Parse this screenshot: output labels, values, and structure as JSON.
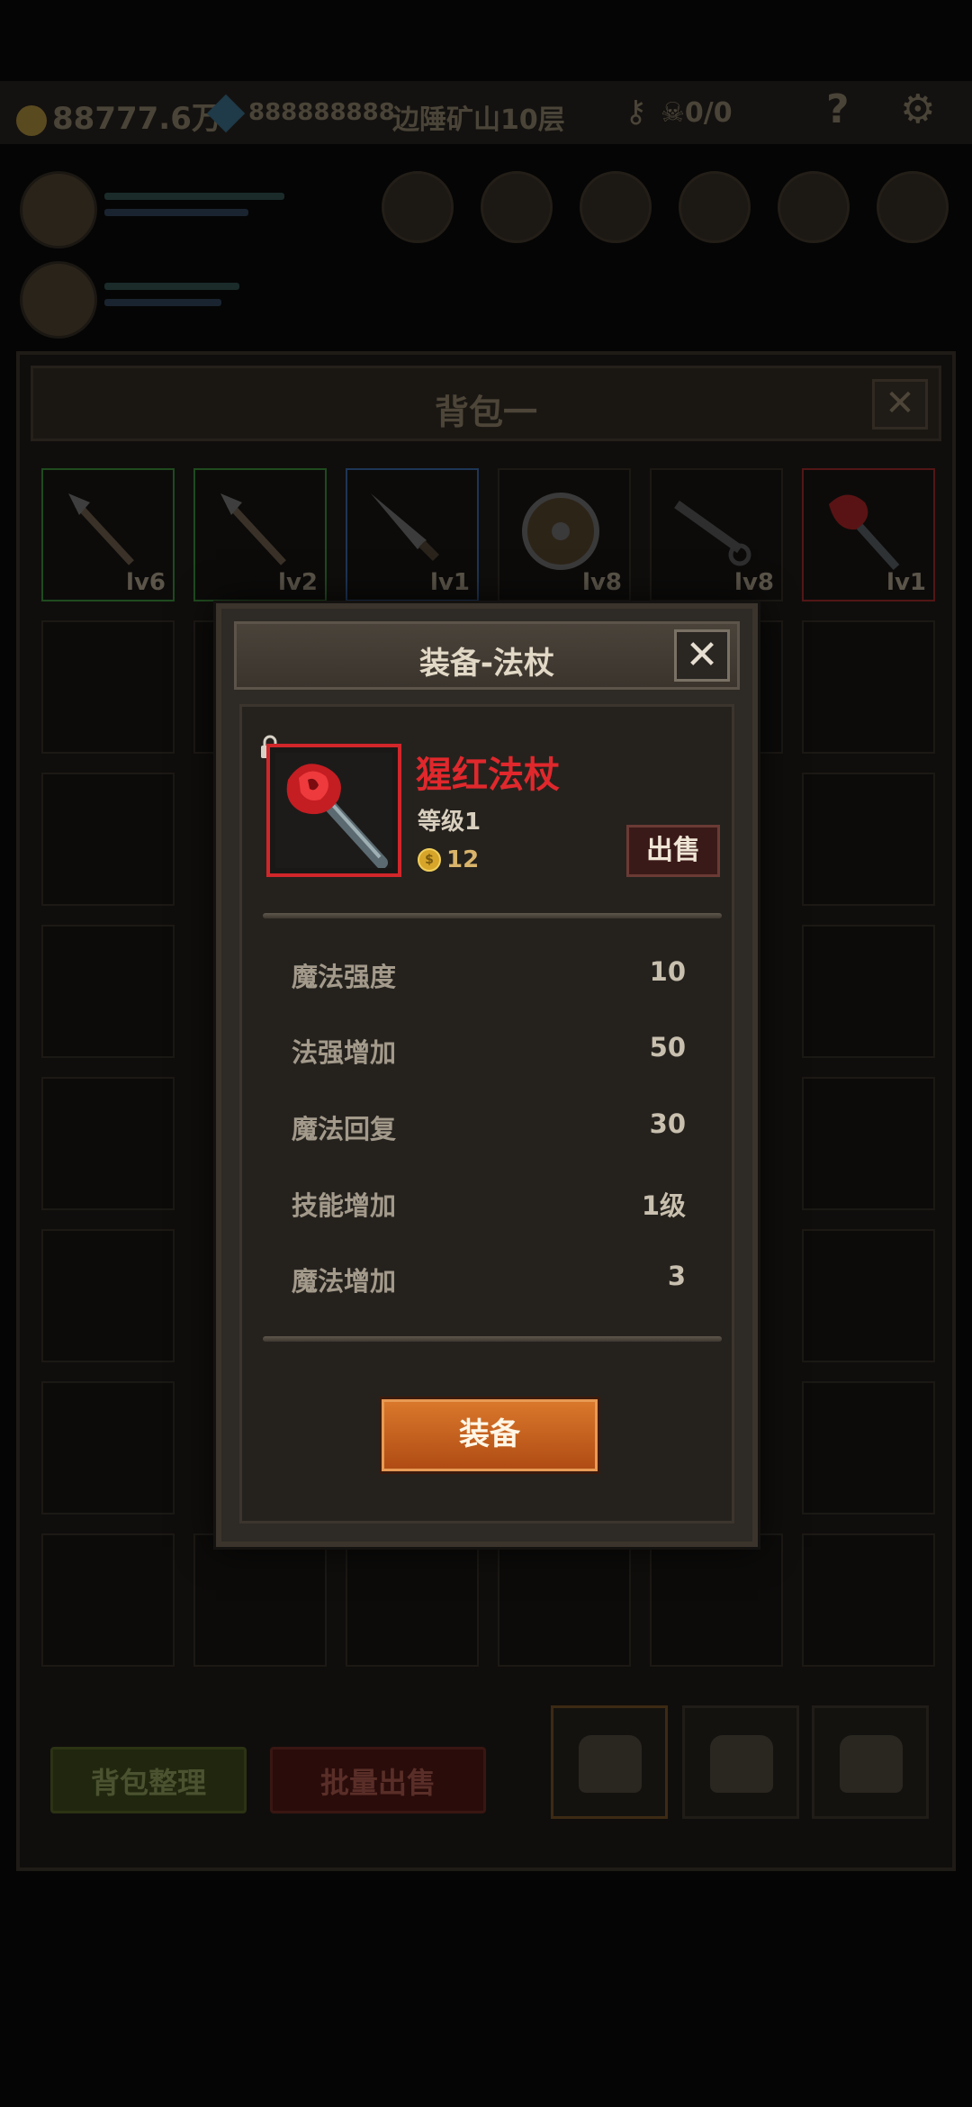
{
  "topbar": {
    "gold": "88777.6万",
    "gems": "888888888",
    "location": "边陲矿山10层",
    "keys": "",
    "kills": "0/0",
    "help": "?"
  },
  "bag": {
    "title": "背包一",
    "close": "✕",
    "items": [
      {
        "level": "lv6",
        "rarity": "green"
      },
      {
        "level": "lv2",
        "rarity": "green"
      },
      {
        "level": "lv1",
        "rarity": "blue"
      },
      {
        "level": "lv8",
        "rarity": "none"
      },
      {
        "level": "lv8",
        "rarity": "none"
      },
      {
        "level": "lv1",
        "rarity": "red"
      }
    ],
    "sort_label": "背包整理",
    "bulk_sell_label": "批量出售"
  },
  "modal": {
    "title": "装备-法杖",
    "close": "✕",
    "item_name": "猩红法杖",
    "item_level": "等级1",
    "price": "12",
    "coin_glyph": "$",
    "sell_label": "出售",
    "stats": [
      {
        "label": "魔法强度",
        "value": "10"
      },
      {
        "label": "法强增加",
        "value": "50"
      },
      {
        "label": "魔法回复",
        "value": "30"
      },
      {
        "label": "技能增加",
        "value": "1级"
      },
      {
        "label": "魔法增加",
        "value": "3"
      }
    ],
    "equip_label": "装备"
  },
  "colors": {
    "rarity_red": "#d1262a",
    "equip_orange": "#c8601f",
    "price_gold": "#d6a52a"
  }
}
